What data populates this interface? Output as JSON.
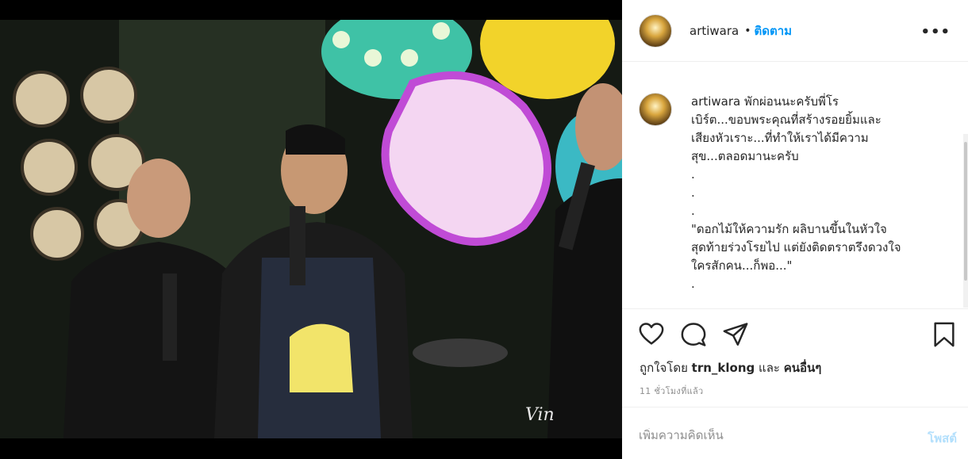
{
  "post": {
    "username": "artiwara",
    "dot": "•",
    "follow_label": "ติดตาม",
    "more_label": "•••",
    "caption": {
      "username": "artiwara",
      "lines": [
        "พักผ่อนนะครับพี่โร",
        "เบิร์ต...ขอบพระคุณที่สร้างรอยยิ้มและ",
        "เสียงหัวเราะ...ที่ทำให้เราได้มีความ",
        "สุข...ตลอดมานะครับ",
        ".",
        ".",
        ".",
        "\"ดอกไม้ให้ความรัก ผลิบานขึ้นในหัวใจ",
        "สุดท้ายร่วงโรยไป แต่ยังติดตราตรึงดวงใจ",
        "ใครสักคน...ก็พอ...\"",
        "."
      ]
    },
    "likes": {
      "prefix": "ถูกใจโดย",
      "user": "trn_klong",
      "conj": "และ",
      "others": "คนอื่นๆ"
    },
    "timestamp": "11 ชั่วโมงที่แล้ว",
    "comment_placeholder": "เพิ่มความคิดเห็น",
    "post_label": "โพสต์",
    "photo_signature": "Vin"
  },
  "icons": {
    "like": "heart-icon",
    "comment": "comment-icon",
    "share": "paper-plane-icon",
    "save": "bookmark-icon"
  },
  "colors": {
    "link": "#0095f6",
    "post_disabled": "#b2dffc",
    "text": "#262626",
    "muted": "#8e8e8e"
  }
}
